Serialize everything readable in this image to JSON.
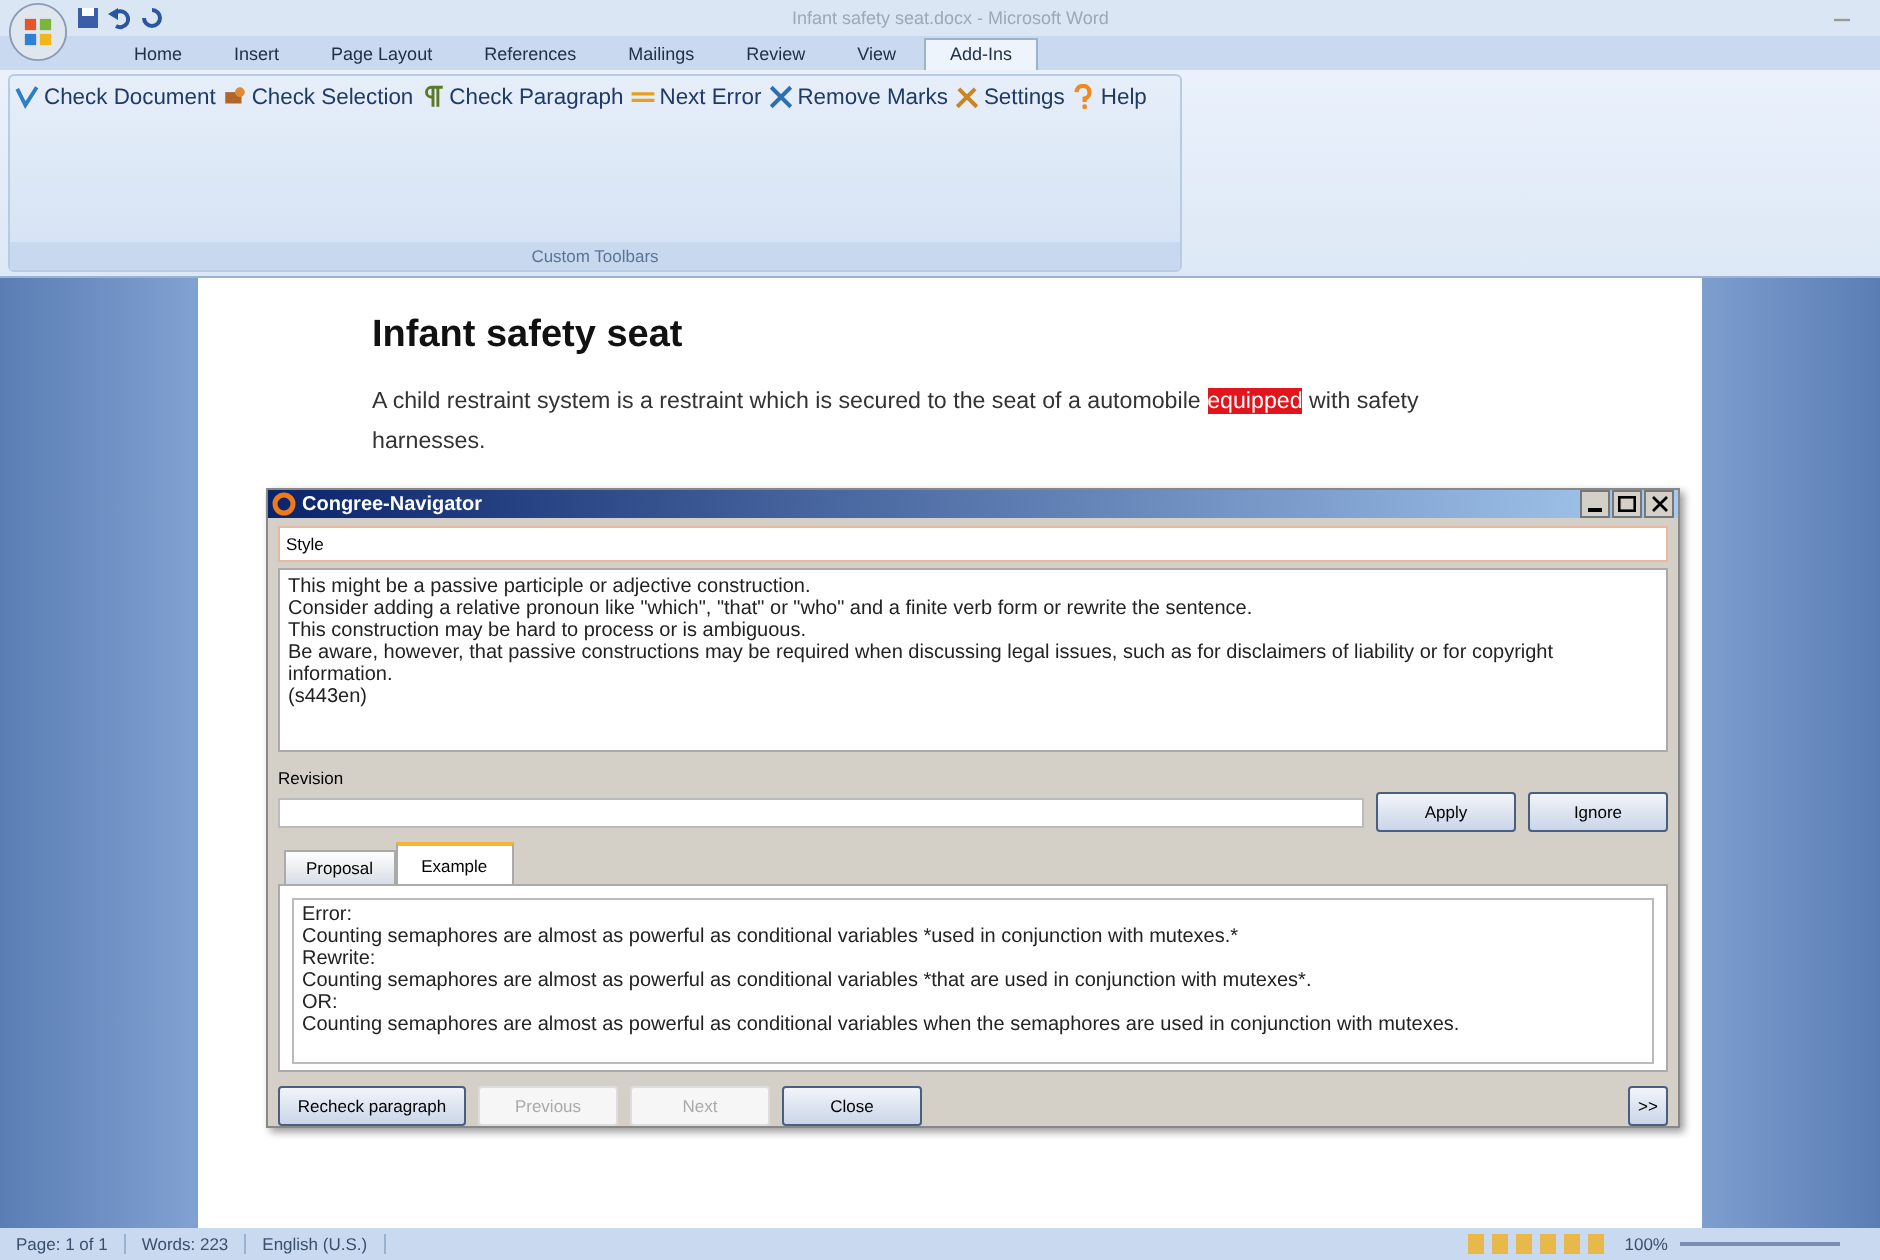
{
  "window": {
    "title": "Infant safety seat.docx - Microsoft Word"
  },
  "ribbon_tabs": [
    {
      "label": "Home",
      "selected": false
    },
    {
      "label": "Insert",
      "selected": false
    },
    {
      "label": "Page Layout",
      "selected": false
    },
    {
      "label": "References",
      "selected": false
    },
    {
      "label": "Mailings",
      "selected": false
    },
    {
      "label": "Review",
      "selected": false
    },
    {
      "label": "View",
      "selected": false
    },
    {
      "label": "Add-Ins",
      "selected": true
    }
  ],
  "toolbar": {
    "group_label": "Custom Toolbars",
    "buttons": [
      {
        "label": "Check Document"
      },
      {
        "label": "Check Selection"
      },
      {
        "label": "Check Paragraph"
      },
      {
        "label": "Next Error"
      },
      {
        "label": "Remove Marks"
      },
      {
        "label": "Settings"
      },
      {
        "label": "Help"
      }
    ]
  },
  "document": {
    "heading": "Infant safety seat",
    "paragraph": {
      "before": "A child restraint system is a restraint which is secured to the seat of a automobile ",
      "flagged": "equipped",
      "after": " with safety harnesses."
    }
  },
  "dialog": {
    "title": "Congree-Navigator",
    "category": "Style",
    "message": [
      "This might be a passive participle or adjective construction.",
      "Consider adding a relative pronoun like \"which\", \"that\" or \"who\" and a finite verb form or rewrite the sentence.",
      "This construction may be hard to process or is ambiguous.",
      "Be aware, however, that passive constructions may be required when discussing legal issues, such as for disclaimers of liability or for copyright information.",
      "(s443en)"
    ],
    "revision_label": "Revision",
    "revision_buttons": [
      "Apply",
      "Ignore"
    ],
    "tabs": [
      {
        "label": "Proposal",
        "selected": false
      },
      {
        "label": "Example",
        "selected": true
      }
    ],
    "example": [
      "Error:",
      "Counting semaphores are almost as powerful as conditional variables *used in conjunction with mutexes.*",
      "Rewrite:",
      "Counting semaphores are almost as powerful as conditional variables *that are used in conjunction with mutexes*.",
      "OR:",
      "Counting semaphores are almost as powerful as conditional variables when the semaphores are used in conjunction with mutexes."
    ],
    "bottom_buttons": [
      {
        "label": "Recheck paragraph",
        "disabled": false
      },
      {
        "label": "Previous",
        "disabled": true
      },
      {
        "label": "Next",
        "disabled": true
      },
      {
        "label": "Close",
        "disabled": false
      }
    ],
    "expand_button": ">>"
  },
  "status_bar": {
    "items": [
      "Page: 1 of 1",
      "Words: 223",
      "English (U.S.)"
    ],
    "zoom": "100%"
  }
}
